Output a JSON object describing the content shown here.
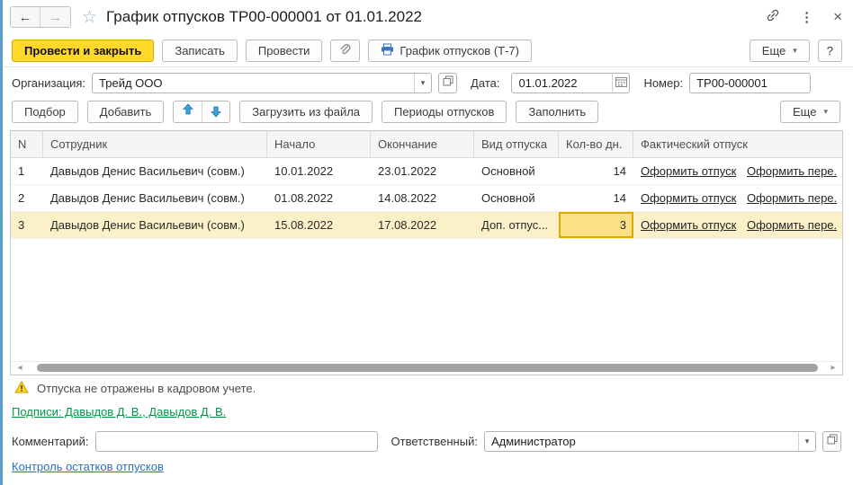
{
  "window": {
    "title": "График отпусков ТР00-000001 от 01.01.2022"
  },
  "icons": {
    "back": "←",
    "forward": "→",
    "star": "☆",
    "more_dots": "⋮",
    "close": "×",
    "chevron_down": "▾",
    "scroll_left": "◂",
    "scroll_right": "▸"
  },
  "command_bar": {
    "post_close": "Провести и закрыть",
    "save": "Записать",
    "post": "Провести",
    "print_report": "График отпусков (Т-7)",
    "more": "Еще",
    "help": "?"
  },
  "form": {
    "organization_label": "Организация:",
    "organization_value": "Трейд ООО",
    "date_label": "Дата:",
    "date_value": "01.01.2022",
    "number_label": "Номер:",
    "number_value": "ТР00-000001"
  },
  "table_toolbar": {
    "pick": "Подбор",
    "add": "Добавить",
    "load_from_file": "Загрузить из файла",
    "vacation_periods": "Периоды отпусков",
    "fill": "Заполнить",
    "more": "Еще"
  },
  "table": {
    "columns": [
      "N",
      "Сотрудник",
      "Начало",
      "Окончание",
      "Вид отпуска",
      "Кол-во дн.",
      "Фактический отпуск"
    ],
    "rows": [
      {
        "n": "1",
        "employee": "Давыдов Денис Васильевич (совм.)",
        "start": "10.01.2022",
        "end": "23.01.2022",
        "type": "Основной",
        "days": "14",
        "action1": "Оформить отпуск",
        "action2": "Оформить пере."
      },
      {
        "n": "2",
        "employee": "Давыдов Денис Васильевич (совм.)",
        "start": "01.08.2022",
        "end": "14.08.2022",
        "type": "Основной",
        "days": "14",
        "action1": "Оформить отпуск",
        "action2": "Оформить пере."
      },
      {
        "n": "3",
        "employee": "Давыдов Денис Васильевич (совм.)",
        "start": "15.08.2022",
        "end": "17.08.2022",
        "type": "Доп. отпус...",
        "days": "3",
        "action1": "Оформить отпуск",
        "action2": "Оформить пере."
      }
    ]
  },
  "warning": {
    "text": "Отпуска не отражены в кадровом учете."
  },
  "signatures": {
    "link": "Подписи: Давыдов Д. В., Давыдов Д. В."
  },
  "footer": {
    "comment_label": "Комментарий:",
    "comment_value": "",
    "responsible_label": "Ответственный:",
    "responsible_value": "Администратор",
    "control_link": "Контроль остатков отпусков"
  },
  "colors": {
    "primary_button": "#ffd829",
    "selected_row": "#fcf0c8",
    "focus_cell_border": "#dfa700",
    "link_green": "#009846",
    "link_blue": "#2d71b8",
    "arrow_blue": "#35a0dc",
    "window_edge": "#579fc7"
  }
}
